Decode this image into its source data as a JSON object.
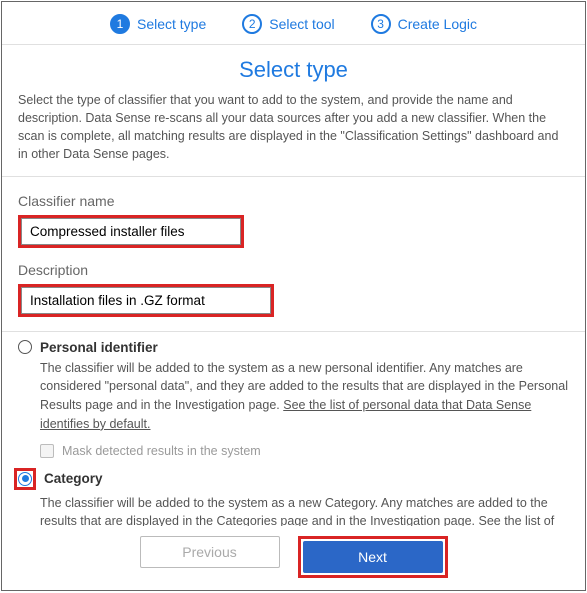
{
  "stepper": {
    "steps": [
      {
        "num": "1",
        "label": "Select type"
      },
      {
        "num": "2",
        "label": "Select tool"
      },
      {
        "num": "3",
        "label": "Create Logic"
      }
    ]
  },
  "title": "Select type",
  "intro": "Select the type of classifier that you want to add to the system, and provide the name and description. Data Sense re-scans all your data sources after you add a new classifier. When the scan is complete, all matching results are displayed in the \"Classification Settings\" dashboard and in other Data Sense pages.",
  "form": {
    "name_label": "Classifier name",
    "name_value": "Compressed installer files",
    "desc_label": "Description",
    "desc_value": "Installation files in .GZ format"
  },
  "options": {
    "personal": {
      "title": "Personal identifier",
      "desc_pre": "The classifier will be added to the system as a new personal identifier. Any matches are considered \"personal data\", and they are added to the results that are displayed in the Personal Results page and in the Investigation page. ",
      "desc_link": "See the list of personal data that Data Sense identifies by default.",
      "mask_label": "Mask detected results in the system"
    },
    "category": {
      "title": "Category",
      "desc_pre": "The classifier will be added to the system as a new Category. Any matches are added to the results that are displayed in the Categories page and in the Investigation page. ",
      "desc_link": "See the list of categories that Data Sense identifies by default."
    }
  },
  "footer": {
    "previous": "Previous",
    "next": "Next"
  }
}
